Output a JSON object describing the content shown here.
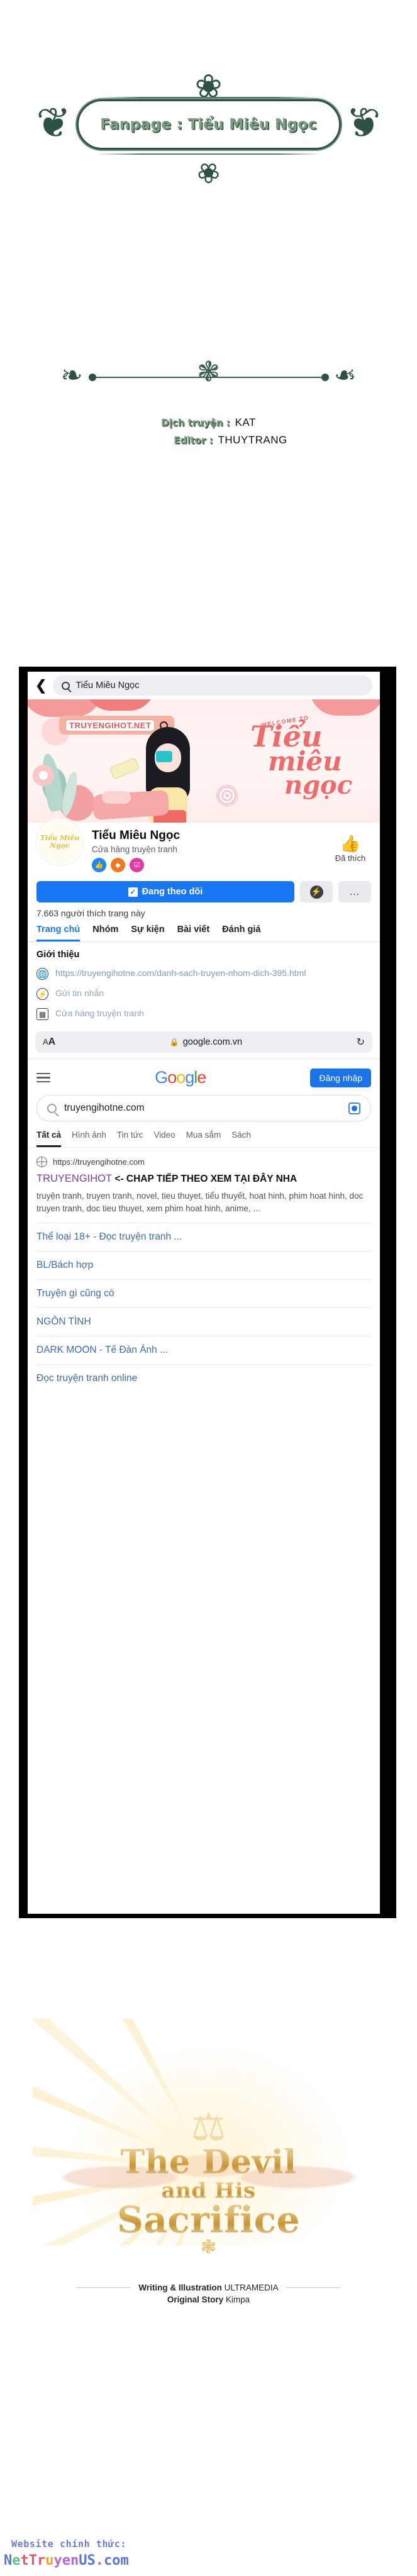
{
  "fanpage_banner": {
    "text": "Fanpage : Tiểu Miêu Ngọc"
  },
  "credits": {
    "translator_label": "Dịch truyện :",
    "translator_name": "KAT",
    "editor_label": "Editor :",
    "editor_name": "THUYTRANG"
  },
  "facebook": {
    "search_query": "Tiểu Miêu Ngọc",
    "back_icon": "chevron-left-icon",
    "cover": {
      "watermark_url": "TRUYENGIHOT.NET",
      "welcome_text": "WELCOME TO",
      "script_line1": "Tiểu",
      "script_line2": "miêu",
      "script_line3": "ngọc"
    },
    "page_name": "Tiểu Miêu Ngọc",
    "page_category": "Cửa hàng truyện tranh",
    "avatar_text": "Tiểu Miêu Ngọc",
    "badges": [
      "blue-badge",
      "orange-badge",
      "pink-badge"
    ],
    "like_icon": "thumbs-up-icon",
    "like_label": "Đã thích",
    "follow_button": "Đang theo dõi",
    "messenger_icon": "messenger-icon",
    "more_icon": "ellipsis-icon",
    "like_count": "7.663 người thích trang này",
    "tabs": [
      {
        "label": "Trang chủ",
        "active": true
      },
      {
        "label": "Nhóm",
        "active": false
      },
      {
        "label": "Sự kiện",
        "active": false
      },
      {
        "label": "Bài viết",
        "active": false
      },
      {
        "label": "Đánh giá",
        "active": false
      }
    ],
    "intro_title": "Giới thiệu",
    "intro_rows": [
      {
        "icon": "globe-icon",
        "text": "https://truyengihotne.com/danh-sach-truyen-nhom-dich-395.html"
      },
      {
        "icon": "messenger-icon",
        "text": "Gửi tin nhắn"
      },
      {
        "icon": "store-icon",
        "text": "Cửa hàng truyện tranh"
      }
    ]
  },
  "safari": {
    "text_size_label": "AA",
    "lock_icon": "lock-icon",
    "host": "google.com.vn",
    "reload_icon": "reload-icon"
  },
  "google": {
    "menu_icon": "hamburger-icon",
    "logo": "Google",
    "signin_label": "Đăng nhập",
    "search_icon": "search-icon",
    "query": "truyengihotne.com",
    "lens_icon": "google-lens-icon",
    "tabs": [
      {
        "label": "Tất cả",
        "active": true
      },
      {
        "label": "Hình ảnh",
        "active": false
      },
      {
        "label": "Tin tức",
        "active": false
      },
      {
        "label": "Video",
        "active": false
      },
      {
        "label": "Mua sắm",
        "active": false
      },
      {
        "label": "Sách",
        "active": false
      }
    ],
    "result": {
      "favicon": "globe-icon",
      "url": "https://truyengihotne.com",
      "title_brand": "TRUYENGIHOT",
      "title_note": "<- CHAP TIẾP THEO XEM TẠI ĐÂY NHA",
      "snippet": "truyện tranh, truyen tranh, novel, tieu thuyet, tiểu thuyết, hoat hinh, phim hoat hinh, doc truyen tranh, doc tieu thuyet, xem phim hoat hinh, anime, ..."
    },
    "sitelinks": [
      "Thể loại 18+ - Đọc truyện tranh ...",
      "BL/Bách hợp",
      "Truyện gì cũng có",
      "NGÔN TÌNH",
      "DARK MOON - Tế Đàn Ánh ...",
      "Đọc truyện tranh online"
    ]
  },
  "title_card": {
    "line1": "The Devil",
    "line2": "and His",
    "line3": "Sacrifice",
    "credit1_bold": "Writing & Illustration",
    "credit1_name": "ULTRAMEDIA",
    "credit2_bold": "Original Story",
    "credit2_name": "Kimpa"
  },
  "footer": {
    "label": "Website chính thức:",
    "site_parts": [
      {
        "text": "N",
        "color": "#5b76d8"
      },
      {
        "text": "e",
        "color": "#63c08a"
      },
      {
        "text": "t",
        "color": "#e8556f"
      },
      {
        "text": "T",
        "color": "#e8556f"
      },
      {
        "text": "r",
        "color": "#e8556f"
      },
      {
        "text": "u",
        "color": "#f0a33c"
      },
      {
        "text": "y",
        "color": "#b06ad0"
      },
      {
        "text": "e",
        "color": "#b06ad0"
      },
      {
        "text": "n",
        "color": "#b06ad0"
      },
      {
        "text": "US",
        "color": "#5b76d8"
      },
      {
        "text": ".",
        "color": "#e8556f"
      },
      {
        "text": "com",
        "color": "#5b76d8"
      }
    ],
    "site_full": "NetTruyenUS.com"
  },
  "colors": {
    "facebook_blue": "#1877f2",
    "google_blue": "#1a73e8",
    "ornament_green": "#2e5146",
    "gold": "#e0b24d"
  }
}
